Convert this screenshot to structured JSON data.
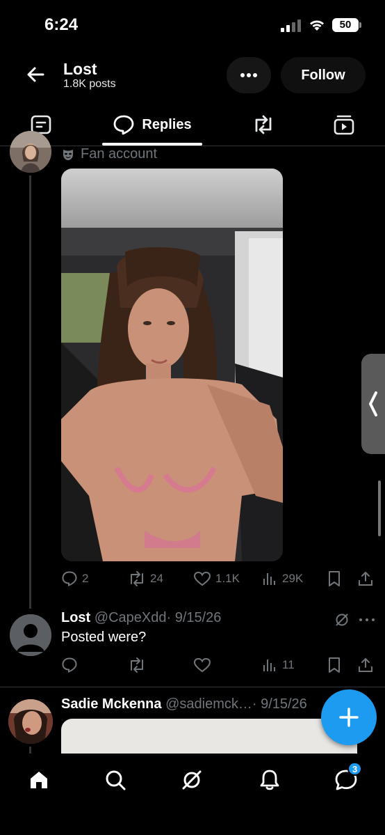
{
  "status_bar": {
    "time": "6:24",
    "battery": "50"
  },
  "header": {
    "title": "Lost",
    "subtitle": "1.8K posts",
    "follow_label": "Follow"
  },
  "tabs": [
    {
      "label": "",
      "icon": "posts-icon"
    },
    {
      "label": "Replies",
      "icon": "speech-bubble-icon"
    },
    {
      "label": "",
      "icon": "repost-icon"
    },
    {
      "label": "",
      "icon": "media-icon"
    }
  ],
  "post": {
    "badge_text": "Fan account",
    "stats": {
      "replies": "2",
      "reposts": "24",
      "likes": "1.1K",
      "views": "29K"
    }
  },
  "reply1": {
    "name": "Lost",
    "handle": "@CapeXdd",
    "date": "· 9/15/26",
    "text": "Posted were?",
    "stats": {
      "views": "11"
    }
  },
  "reply2": {
    "name": "Sadie Mckenna",
    "handle": "@sadiemck…",
    "date": "· 9/15/26"
  },
  "nav": {
    "messages_badge": "3"
  },
  "colors": {
    "accent": "#1d9bf0",
    "background": "#000000",
    "muted": "#71767b"
  }
}
